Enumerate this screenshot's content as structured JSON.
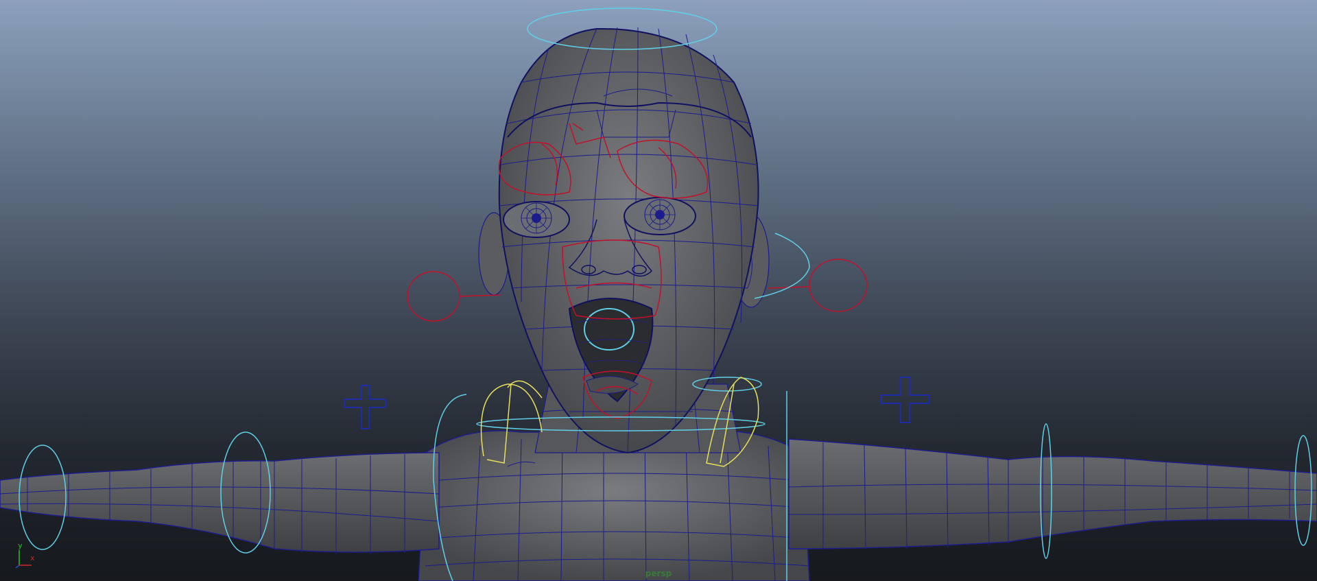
{
  "viewport": {
    "camera_label": "persp",
    "axis_labels": {
      "y": "y",
      "x": "x"
    }
  },
  "colors": {
    "mesh_fill": "#5e6064",
    "wireframe": "#1c1c8c",
    "control_red": "#c4102a",
    "control_cyan": "#5fd0e8",
    "control_yellow": "#e8e05a",
    "control_blue": "#1a2acc",
    "axis_y": "#28c028",
    "axis_x": "#d02828",
    "camera_label": "#3a7a3a"
  },
  "icons": [
    "axis-gizmo-icon",
    "locator-cross-icon",
    "control-circle-icon"
  ]
}
